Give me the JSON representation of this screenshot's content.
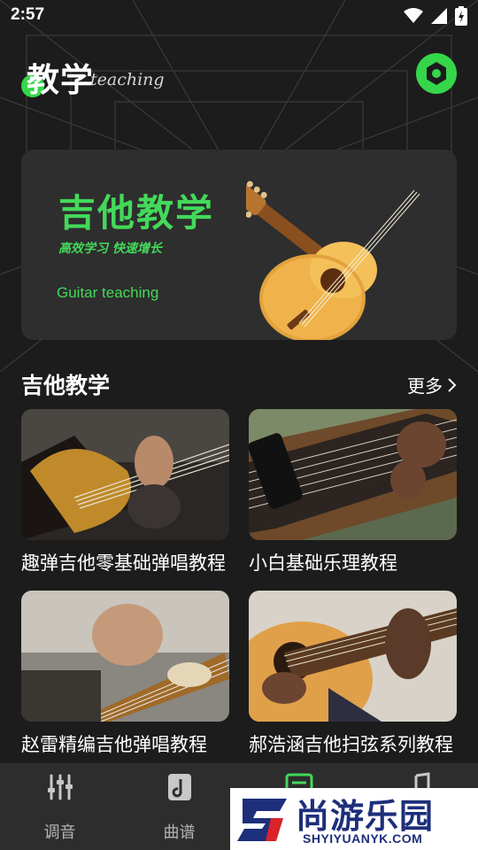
{
  "status_bar": {
    "time": "2:57",
    "icons": [
      "wifi-icon",
      "signal-icon",
      "battery-icon"
    ]
  },
  "header": {
    "title": "教学",
    "subtitle": "teaching",
    "settings_icon": "settings-ring-icon"
  },
  "banner": {
    "title": "吉他教学",
    "slogan": "高效学习  快速增长",
    "english": "Guitar teaching",
    "image": "acoustic-guitar"
  },
  "section": {
    "title": "吉他教学",
    "more_label": "更多",
    "more_icon": "chevron-right-icon"
  },
  "cards": [
    {
      "title": "趣弹吉他零基础弹唱教程",
      "image": "electric-guitar-strumming"
    },
    {
      "title": "小白基础乐理教程",
      "image": "guitar-fretboard-hand"
    },
    {
      "title": "赵雷精编吉他弹唱教程",
      "image": "guitar-headstock-closeup"
    },
    {
      "title": "郝浩涵吉他扫弦系列教程",
      "image": "acoustic-guitar-playing"
    }
  ],
  "tabbar": {
    "tabs": [
      {
        "label": "调音",
        "icon": "equalizer-icon",
        "active": false
      },
      {
        "label": "曲谱",
        "icon": "music-book-icon",
        "active": false
      },
      {
        "label": "",
        "icon": "lesson-icon",
        "active": true
      },
      {
        "label": "",
        "icon": "music-note-icon",
        "active": false
      }
    ]
  },
  "watermark": {
    "title": "尚游乐园",
    "url": "SHYIYUANYK.COM",
    "logo": "s-logo"
  },
  "colors": {
    "accent": "#43d95a",
    "background": "#1c1c1c",
    "card_bg": "#2e2e2e",
    "tabbar_bg": "#2d2d2d",
    "watermark_blue": "#1d2f7a",
    "watermark_red": "#d8232a"
  }
}
